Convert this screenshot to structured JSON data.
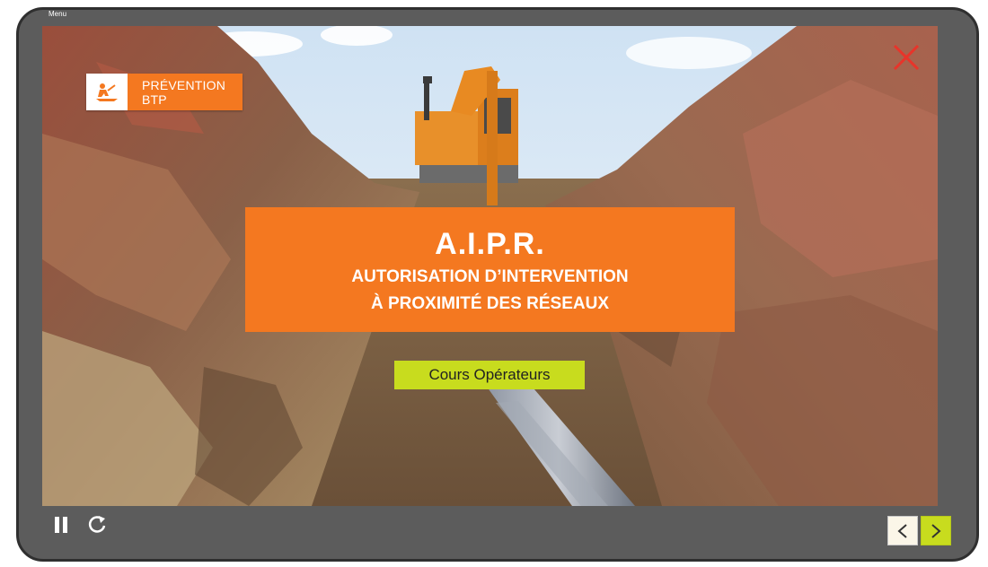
{
  "menu": {
    "label": "Menu"
  },
  "brand": {
    "name": "PRÉVENTION BTP",
    "icon": "worker-digging-icon"
  },
  "title": {
    "main": "A.I.P.R.",
    "line1": "AUTORISATION D’INTERVENTION",
    "line2": "À PROXIMITÉ DES RÉSEAUX"
  },
  "course": {
    "label": "Cours Opérateurs"
  },
  "controls": {
    "pause_icon": "pause-icon",
    "replay_icon": "replay-icon",
    "prev_icon": "chevron-left-icon",
    "next_icon": "chevron-right-icon",
    "close_icon": "close-icon"
  },
  "colors": {
    "accent": "#f47820",
    "highlight": "#c8dc1e",
    "frame": "#5c5c5c",
    "close": "#e8342a"
  }
}
